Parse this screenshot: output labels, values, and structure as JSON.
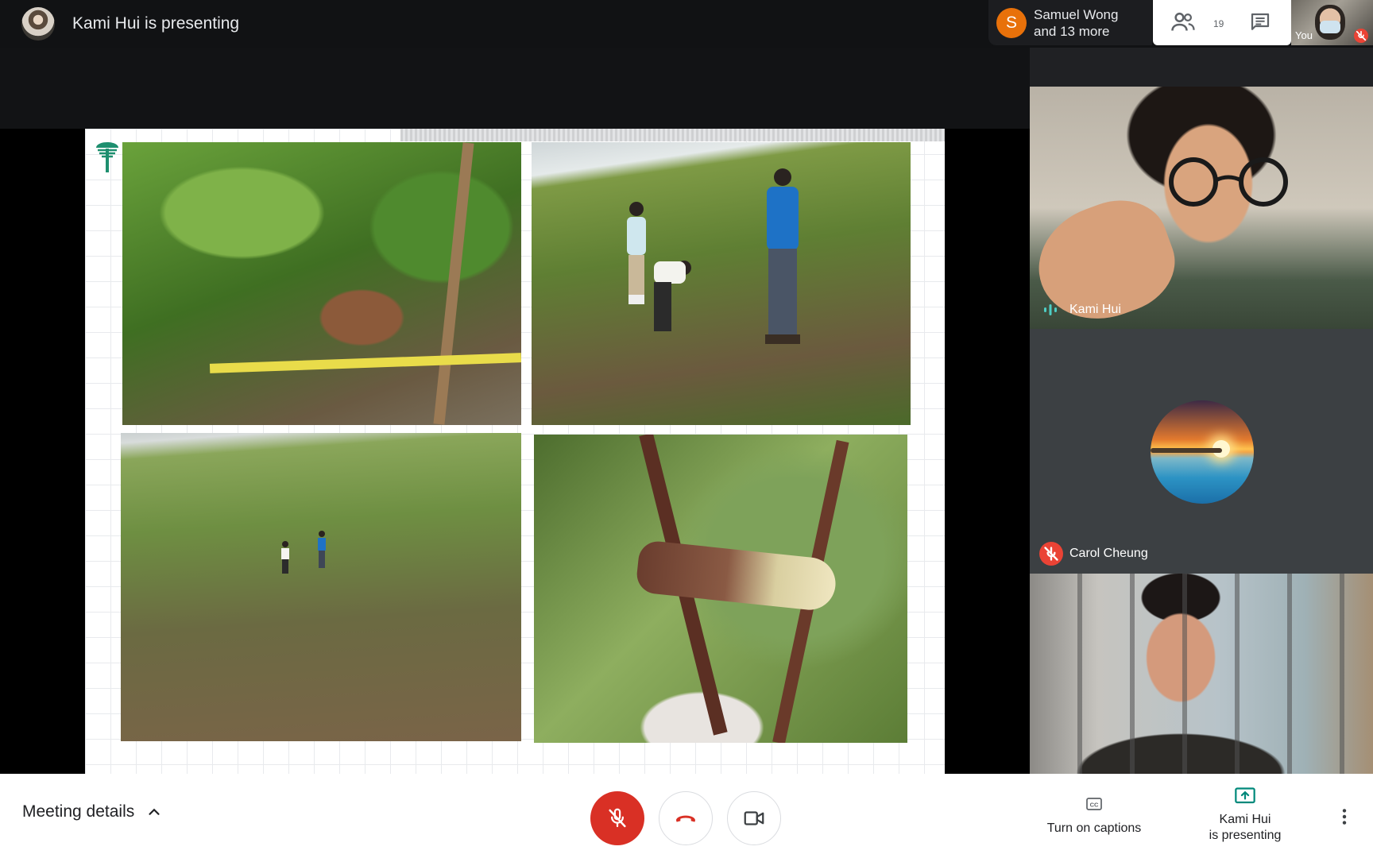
{
  "topbar": {
    "presenter_label": "Kami Hui is presenting",
    "participant_initial": "S",
    "participant_name": "Samuel Wong",
    "participant_more": "and 13 more",
    "people_count": "19",
    "self_label": "You"
  },
  "tiles": {
    "kami_name": "Kami Hui",
    "carol_name": "Carol Cheung"
  },
  "bottombar": {
    "meeting_details": "Meeting details",
    "captions_label": "Turn on captions",
    "present_line1": "Kami Hui",
    "present_line2": "is presenting"
  },
  "colors": {
    "mute_red": "#d93025",
    "accent_green": "#00897b",
    "avatar_orange": "#e8710a"
  },
  "icons": [
    "people-icon",
    "chat-icon",
    "mic-off-icon",
    "call-end-icon",
    "videocam-icon",
    "captions-icon",
    "present-screen-icon",
    "more-vert-icon",
    "chevron-up-icon",
    "speaking-icon"
  ]
}
